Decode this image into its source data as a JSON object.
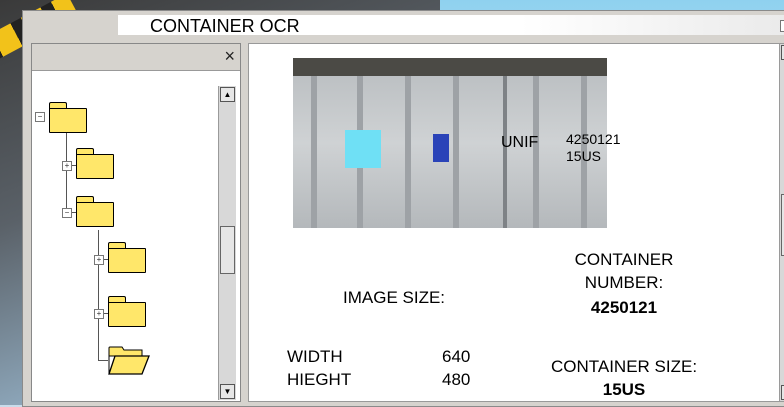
{
  "window": {
    "title": "CONTAINER OCR"
  },
  "tree": {
    "close_glyph": "×",
    "expander_plus": "+",
    "expander_minus": "−",
    "scroll_up": "▲",
    "scroll_down": "▼",
    "folders": [
      {
        "name": "folder-icon",
        "state": "closed"
      },
      {
        "name": "folder-icon",
        "state": "closed"
      },
      {
        "name": "folder-icon",
        "state": "closed"
      },
      {
        "name": "folder-icon",
        "state": "closed"
      },
      {
        "name": "folder-icon",
        "state": "closed"
      },
      {
        "name": "folder-open-icon",
        "state": "open"
      }
    ]
  },
  "photo": {
    "ocr_prefix": "UNIF",
    "ocr_number": "4250121",
    "ocr_size": "15US"
  },
  "image_info": {
    "heading": "IMAGE SIZE:",
    "width_label": "WIDTH",
    "width_value": "640",
    "height_label": "HIEGHT",
    "height_value": "480"
  },
  "container_info": {
    "number_heading_line1": "CONTAINER",
    "number_heading_line2": "NUMBER:",
    "number_value": "4250121",
    "size_heading": "CONTAINER SIZE:",
    "size_value": "15US"
  },
  "colors": {
    "folder_fill": "#ffe76a",
    "window_chrome": "#d6d3ce",
    "sticker": "#6fe0f5"
  }
}
